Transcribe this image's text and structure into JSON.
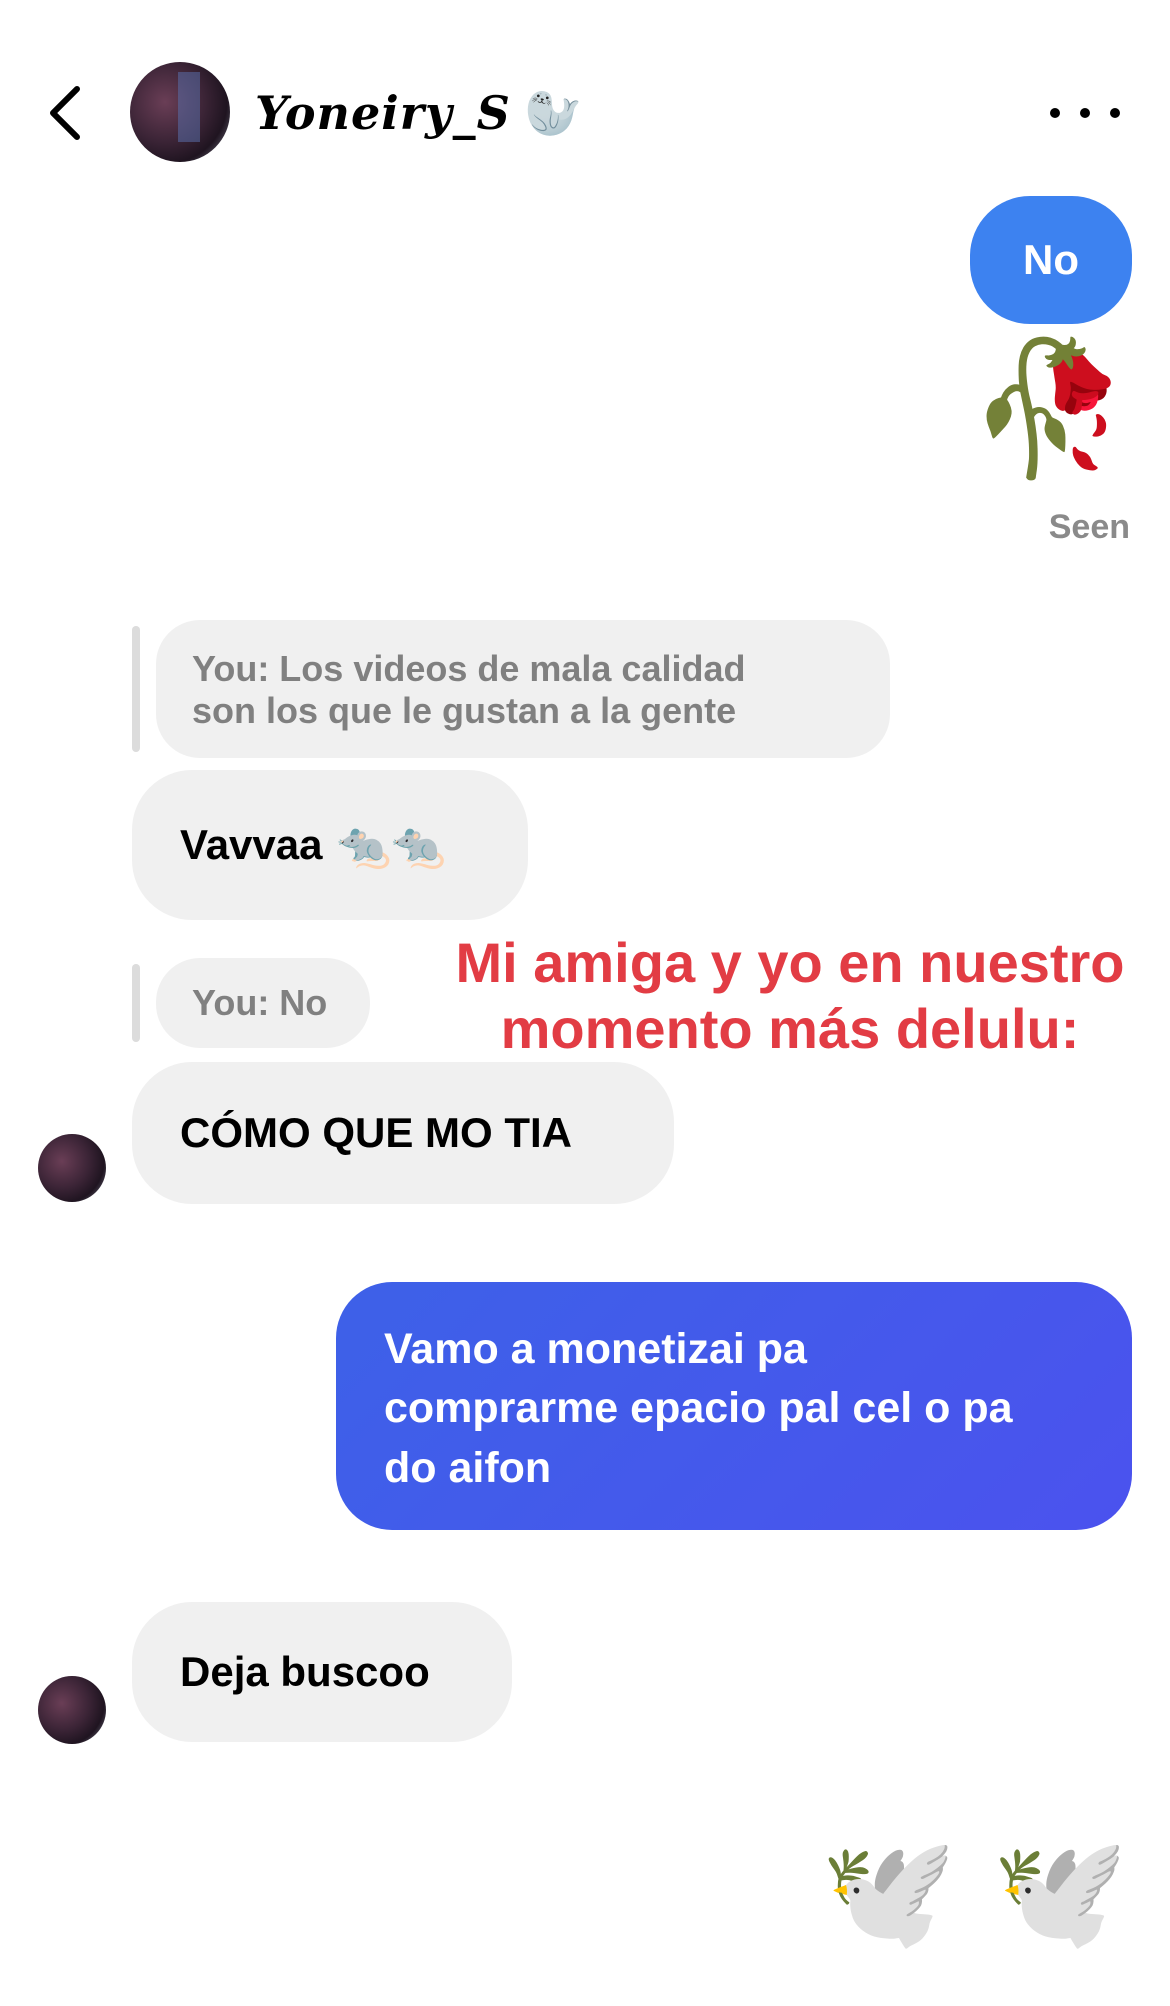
{
  "header": {
    "username": "Yoneiry_S",
    "username_emoji": "🦭",
    "back_icon": "chevron-left-icon",
    "more_icon": "more-horizontal-icon"
  },
  "messages": {
    "out_no": "No",
    "wilted_rose": "🥀",
    "seen": "Seen",
    "reply_quote_1": "You: Los videos de mala calidad son los que le gustan a la gente",
    "reply_quote_1_line1": "You: Los videos de mala calidad",
    "reply_quote_1_line2": "son los que le gustan a la gente",
    "in_vavvaa": "Vavvaa",
    "rats": "🐀🐀",
    "reply_quote_2": "You: No",
    "in_como": "CÓMO QUE MO TIA",
    "out_long_line1": "Vamo a monetizai pa",
    "out_long_line2": "comprarme epacio pal cel o pa",
    "out_long_line3": "do aifon",
    "in_deja": "Deja buscoo",
    "doves": "🕊️ 🕊️"
  },
  "overlay": {
    "line1": "Mi amiga y yo en nuestro",
    "line2": "momento más delulu:",
    "color": "#e23c44"
  },
  "colors": {
    "outgoing_bubble": "#3d82f0",
    "outgoing_gradient_bubble": "#4b52ee",
    "incoming_bubble": "#f0f0f0",
    "quote_text": "#808080"
  }
}
